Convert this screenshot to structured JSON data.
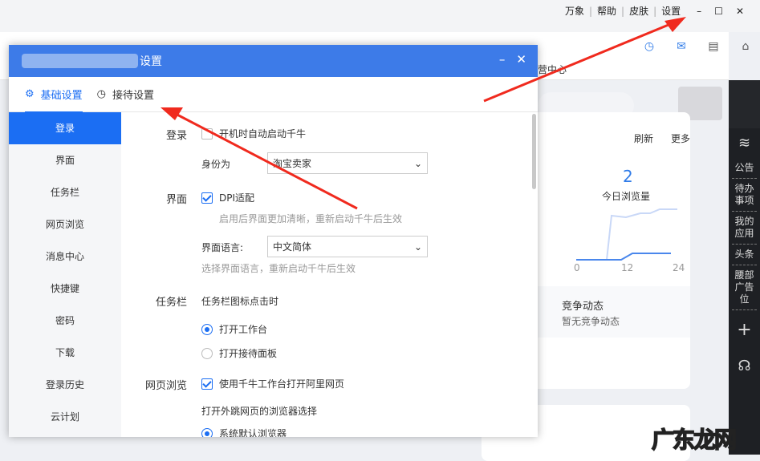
{
  "app": {
    "top_menu": [
      "万象",
      "帮助",
      "皮肤",
      "设置"
    ],
    "window_controls": [
      "–",
      "☐",
      "✕"
    ]
  },
  "background": {
    "tab_fragment": "营中心",
    "refresh": "刷新",
    "more": "更多",
    "view_count": "2",
    "view_label": "今日浏览量",
    "chart_ticks": [
      "0",
      "12",
      "24"
    ],
    "competition_title": "竞争动态",
    "competition_sub": "暂无竞争动态"
  },
  "right_sidebar": [
    "公告",
    "待办事项",
    "我的应用",
    "头条",
    "腰部广告位"
  ],
  "dialog": {
    "title_suffix": "设置",
    "controls": [
      "–",
      "✕"
    ],
    "tabs": [
      {
        "label": "基础设置",
        "active": true
      },
      {
        "label": "接待设置",
        "active": false
      }
    ],
    "nav": [
      "登录",
      "界面",
      "任务栏",
      "网页浏览",
      "消息中心",
      "快捷键",
      "密码",
      "下载",
      "登录历史",
      "云计划"
    ],
    "login": {
      "section": "登录",
      "autostart": "开机时自动启动千牛",
      "autostart_checked": false,
      "identity_label": "身份为",
      "identity_value": "淘宝卖家"
    },
    "ui": {
      "section": "界面",
      "dpi": "DPI适配",
      "dpi_checked": true,
      "dpi_hint": "启用后界面更加清晰，重新启动千牛后生效",
      "lang_label": "界面语言:",
      "lang_value": "中文简体",
      "lang_hint": "选择界面语言，重新启动千牛后生效"
    },
    "taskbar": {
      "section": "任务栏",
      "desc": "任务栏图标点击时",
      "options": [
        "打开工作台",
        "打开接待面板"
      ],
      "selected": 0
    },
    "web": {
      "section": "网页浏览",
      "use_workbench": "使用千牛工作台打开阿里网页",
      "use_checked": true,
      "browser_label": "打开外跳网页的浏览器选择",
      "browser_option": "系统默认浏览器"
    }
  },
  "watermark": "广东龙网",
  "colors": {
    "accent": "#1b6ef3",
    "titlebar": "#3d7be8",
    "annotation": "#f02a1e"
  }
}
